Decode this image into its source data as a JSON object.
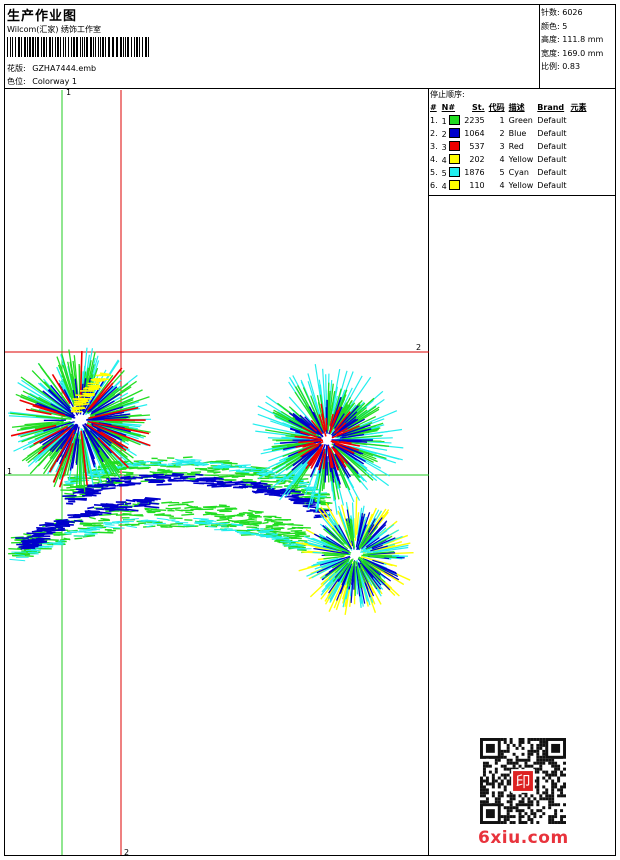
{
  "header": {
    "title": "生产作业图",
    "software": "Wilcom(汇家) 绣饰工作室",
    "design_label": "花版:",
    "design_file": "GZHA7444.emb",
    "colorway_label": "色位:",
    "colorway": "Colorway 1"
  },
  "stats": [
    {
      "label": "针数:",
      "value": "6026"
    },
    {
      "label": "颜色:",
      "value": "5"
    },
    {
      "label": "高度:",
      "value": "111.8 mm"
    },
    {
      "label": "宽度:",
      "value": "169.0 mm"
    },
    {
      "label": "比例:",
      "value": "0.83"
    }
  ],
  "stop_sequence": {
    "title": "停止顺序:",
    "columns": [
      "#",
      "N#",
      "St.",
      "代码",
      "描述",
      "Brand",
      "元素"
    ],
    "rows": [
      {
        "idx": "1.",
        "n": "1",
        "color": "#22dd22",
        "stitches": "2235",
        "code": "1",
        "desc": "Green",
        "brand": "Default"
      },
      {
        "idx": "2.",
        "n": "2",
        "color": "#0000cc",
        "stitches": "1064",
        "code": "2",
        "desc": "Blue",
        "brand": "Default"
      },
      {
        "idx": "3.",
        "n": "3",
        "color": "#ee0000",
        "stitches": "537",
        "code": "3",
        "desc": "Red",
        "brand": "Default"
      },
      {
        "idx": "4.",
        "n": "4",
        "color": "#ffff00",
        "stitches": "202",
        "code": "4",
        "desc": "Yellow",
        "brand": "Default"
      },
      {
        "idx": "5.",
        "n": "5",
        "color": "#22eeee",
        "stitches": "1876",
        "code": "5",
        "desc": "Cyan",
        "brand": "Default"
      },
      {
        "idx": "6.",
        "n": "4",
        "color": "#ffff00",
        "stitches": "110",
        "code": "4",
        "desc": "Yellow",
        "brand": "Default"
      }
    ]
  },
  "guides": {
    "v1": "1",
    "v2": "2",
    "h1": "1",
    "h2": "2"
  },
  "watermark": "6xiu.com",
  "seal_text": "印"
}
